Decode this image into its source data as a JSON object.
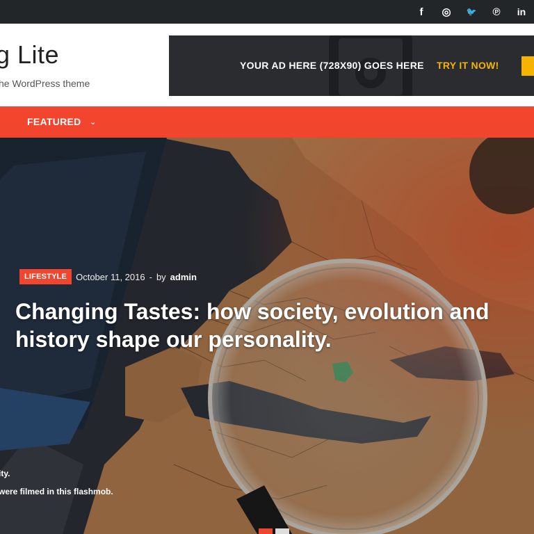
{
  "topbar": {
    "social": [
      {
        "icon": "facebook-icon",
        "glyph": "f"
      },
      {
        "icon": "instagram-icon",
        "glyph": "◎"
      },
      {
        "icon": "twitter-icon",
        "glyph": "🐦"
      },
      {
        "icon": "pinterest-icon",
        "glyph": "℗"
      },
      {
        "icon": "linkedin-icon",
        "glyph": "in"
      }
    ]
  },
  "header": {
    "site_title": "g Lite",
    "tagline": "he WordPress theme"
  },
  "ad": {
    "text": "YOUR AD HERE (728X90) GOES HERE",
    "cta": "TRY IT NOW!"
  },
  "nav": {
    "item_label": "FEATURED",
    "chevron": "⌄"
  },
  "hero": {
    "category": "LIFESTYLE",
    "date": "October 11, 2016",
    "separator": "-",
    "by": "by",
    "author": "admin",
    "headline": "Changing Tastes: how society, evolution and history shape our personality.",
    "side_text_1": "ity.",
    "side_text_2": "were filmed in this flashmob."
  },
  "colors": {
    "accent": "#f2452e",
    "topbar": "#232629",
    "ad_cta": "#f5b400"
  }
}
